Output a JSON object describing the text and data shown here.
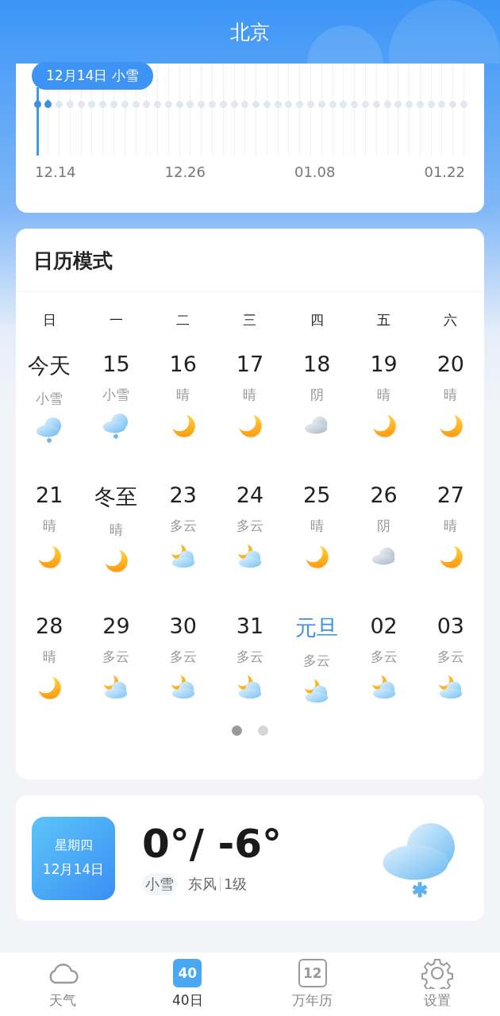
{
  "header": {
    "title": "北京"
  },
  "timeline": {
    "tooltip": "12月14日 小雪",
    "days": [
      {
        "snow": true,
        "selected": true
      },
      {
        "snow": true,
        "selected": false
      },
      {
        "snow": false,
        "selected": false
      },
      {
        "snow": false,
        "selected": false
      },
      {
        "snow": false,
        "selected": false
      },
      {
        "snow": false,
        "selected": false
      },
      {
        "snow": false,
        "selected": false
      },
      {
        "snow": false,
        "selected": false
      },
      {
        "snow": false,
        "selected": false
      },
      {
        "snow": false,
        "selected": false
      },
      {
        "snow": false,
        "selected": false
      },
      {
        "snow": false,
        "selected": false
      },
      {
        "snow": false,
        "selected": false
      },
      {
        "snow": false,
        "selected": false
      },
      {
        "snow": false,
        "selected": false
      },
      {
        "snow": false,
        "selected": false
      },
      {
        "snow": false,
        "selected": false
      },
      {
        "snow": false,
        "selected": false
      },
      {
        "snow": false,
        "selected": false
      },
      {
        "snow": false,
        "selected": false
      },
      {
        "snow": false,
        "selected": false
      },
      {
        "snow": false,
        "selected": false
      },
      {
        "snow": false,
        "selected": false
      },
      {
        "snow": false,
        "selected": false
      },
      {
        "snow": false,
        "selected": false
      },
      {
        "snow": false,
        "selected": false
      },
      {
        "snow": false,
        "selected": false
      },
      {
        "snow": false,
        "selected": false
      },
      {
        "snow": false,
        "selected": false
      },
      {
        "snow": false,
        "selected": false
      },
      {
        "snow": false,
        "selected": false
      },
      {
        "snow": false,
        "selected": false
      },
      {
        "snow": false,
        "selected": false
      },
      {
        "snow": false,
        "selected": false
      },
      {
        "snow": false,
        "selected": false
      },
      {
        "snow": false,
        "selected": false
      },
      {
        "snow": false,
        "selected": false
      },
      {
        "snow": false,
        "selected": false
      },
      {
        "snow": false,
        "selected": false
      },
      {
        "snow": false,
        "selected": false
      }
    ],
    "labels": [
      "12.14",
      "12.26",
      "01.08",
      "01.22"
    ]
  },
  "calendar": {
    "title": "日历模式",
    "weekdays": [
      "日",
      "一",
      "二",
      "三",
      "四",
      "五",
      "六"
    ],
    "days": [
      {
        "label": "今天",
        "weather": "小雪",
        "kind": "snow",
        "holiday": false
      },
      {
        "label": "15",
        "weather": "小雪",
        "kind": "snow",
        "holiday": false
      },
      {
        "label": "16",
        "weather": "晴",
        "kind": "moon",
        "holiday": false
      },
      {
        "label": "17",
        "weather": "晴",
        "kind": "moon",
        "holiday": false
      },
      {
        "label": "18",
        "weather": "阴",
        "kind": "overcast",
        "holiday": false
      },
      {
        "label": "19",
        "weather": "晴",
        "kind": "moon",
        "holiday": false
      },
      {
        "label": "20",
        "weather": "晴",
        "kind": "moon",
        "holiday": false
      },
      {
        "label": "21",
        "weather": "晴",
        "kind": "moon",
        "holiday": false
      },
      {
        "label": "冬至",
        "weather": "晴",
        "kind": "moon",
        "holiday": false
      },
      {
        "label": "23",
        "weather": "多云",
        "kind": "partly",
        "holiday": false
      },
      {
        "label": "24",
        "weather": "多云",
        "kind": "partly",
        "holiday": false
      },
      {
        "label": "25",
        "weather": "晴",
        "kind": "moon",
        "holiday": false
      },
      {
        "label": "26",
        "weather": "阴",
        "kind": "overcast",
        "holiday": false
      },
      {
        "label": "27",
        "weather": "晴",
        "kind": "moon",
        "holiday": false
      },
      {
        "label": "28",
        "weather": "晴",
        "kind": "moon",
        "holiday": false
      },
      {
        "label": "29",
        "weather": "多云",
        "kind": "partly",
        "holiday": false
      },
      {
        "label": "30",
        "weather": "多云",
        "kind": "partly",
        "holiday": false
      },
      {
        "label": "31",
        "weather": "多云",
        "kind": "partly",
        "holiday": false
      },
      {
        "label": "元旦",
        "weather": "多云",
        "kind": "partly",
        "holiday": true
      },
      {
        "label": "02",
        "weather": "多云",
        "kind": "partly",
        "holiday": false
      },
      {
        "label": "03",
        "weather": "多云",
        "kind": "partly",
        "holiday": false
      }
    ],
    "pages": [
      {
        "selected": true
      },
      {
        "selected": false
      }
    ]
  },
  "today": {
    "weekday": "星期四",
    "date": "12月14日",
    "temperature": "0°/ -6°",
    "weather": "小雪",
    "wind": "东风",
    "wind_level": "1级",
    "kind": "snow"
  },
  "tabs": [
    {
      "label": "天气",
      "kind": "cloud",
      "selected": false
    },
    {
      "label": "40日",
      "kind": "forty",
      "icon_text": "40",
      "selected": true
    },
    {
      "label": "万年历",
      "kind": "calendar",
      "icon_text": "12",
      "selected": false
    },
    {
      "label": "设置",
      "kind": "gear",
      "selected": false
    }
  ]
}
